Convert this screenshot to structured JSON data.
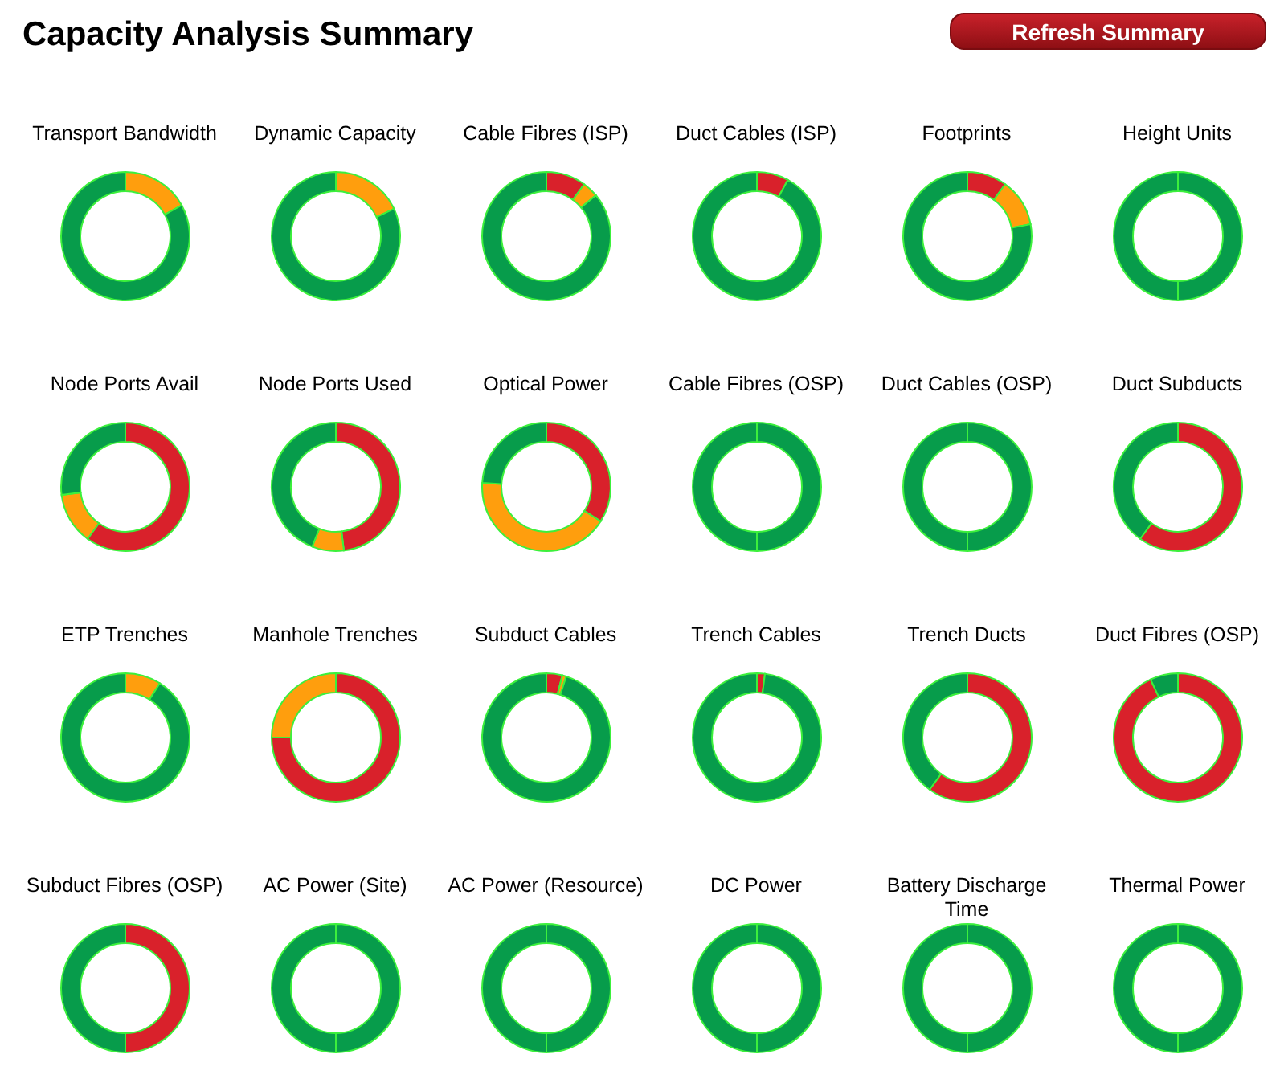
{
  "title": "Capacity Analysis Summary",
  "refresh_button": "Refresh Summary",
  "gauges": [
    {
      "label": "Transport Bandwidth",
      "chart_data": {
        "type": "donut",
        "values": [
          17,
          83
        ],
        "colors": [
          "#ff9e0d",
          "#079c4b"
        ]
      }
    },
    {
      "label": "Dynamic Capacity",
      "chart_data": {
        "type": "donut",
        "values": [
          18,
          82
        ],
        "colors": [
          "#ff9e0d",
          "#079c4b"
        ]
      }
    },
    {
      "label": "Cable Fibres (ISP)",
      "chart_data": {
        "type": "donut",
        "values": [
          10,
          4,
          86
        ],
        "colors": [
          "#d9212b",
          "#ff9e0d",
          "#079c4b"
        ]
      }
    },
    {
      "label": "Duct Cables (ISP)",
      "chart_data": {
        "type": "donut",
        "values": [
          8,
          92
        ],
        "colors": [
          "#d9212b",
          "#079c4b"
        ]
      }
    },
    {
      "label": "Footprints",
      "chart_data": {
        "type": "donut",
        "values": [
          10,
          12,
          78
        ],
        "colors": [
          "#d9212b",
          "#ff9e0d",
          "#079c4b"
        ]
      }
    },
    {
      "label": "Height Units",
      "chart_data": {
        "type": "donut",
        "values": [
          50,
          50
        ],
        "colors": [
          "#079c4b",
          "#079c4b"
        ]
      }
    },
    {
      "label": "Node Ports Avail",
      "chart_data": {
        "type": "donut",
        "values": [
          60,
          13,
          27
        ],
        "colors": [
          "#d9212b",
          "#ff9e0d",
          "#079c4b"
        ]
      }
    },
    {
      "label": "Node Ports Used",
      "chart_data": {
        "type": "donut",
        "values": [
          48,
          8,
          44
        ],
        "colors": [
          "#d9212b",
          "#ff9e0d",
          "#079c4b"
        ]
      }
    },
    {
      "label": "Optical Power",
      "chart_data": {
        "type": "donut",
        "values": [
          34,
          42,
          24
        ],
        "colors": [
          "#d9212b",
          "#ff9e0d",
          "#079c4b"
        ]
      }
    },
    {
      "label": "Cable Fibres (OSP)",
      "chart_data": {
        "type": "donut",
        "values": [
          50,
          50
        ],
        "colors": [
          "#079c4b",
          "#079c4b"
        ]
      }
    },
    {
      "label": "Duct Cables (OSP)",
      "chart_data": {
        "type": "donut",
        "values": [
          50,
          50
        ],
        "colors": [
          "#079c4b",
          "#079c4b"
        ]
      }
    },
    {
      "label": "Duct Subducts",
      "chart_data": {
        "type": "donut",
        "values": [
          60,
          40
        ],
        "colors": [
          "#d9212b",
          "#079c4b"
        ]
      }
    },
    {
      "label": "ETP Trenches",
      "chart_data": {
        "type": "donut",
        "values": [
          9,
          91
        ],
        "colors": [
          "#ff9e0d",
          "#079c4b"
        ]
      }
    },
    {
      "label": "Manhole Trenches",
      "chart_data": {
        "type": "donut",
        "values": [
          75,
          25
        ],
        "colors": [
          "#d9212b",
          "#ff9e0d"
        ]
      }
    },
    {
      "label": "Subduct Cables",
      "chart_data": {
        "type": "donut",
        "values": [
          4,
          1,
          95
        ],
        "colors": [
          "#d9212b",
          "#ff9e0d",
          "#079c4b"
        ]
      }
    },
    {
      "label": "Trench Cables",
      "chart_data": {
        "type": "donut",
        "values": [
          2,
          98
        ],
        "colors": [
          "#d9212b",
          "#079c4b"
        ]
      }
    },
    {
      "label": "Trench Ducts",
      "chart_data": {
        "type": "donut",
        "values": [
          60,
          40
        ],
        "colors": [
          "#d9212b",
          "#079c4b"
        ]
      }
    },
    {
      "label": "Duct Fibres (OSP)",
      "chart_data": {
        "type": "donut",
        "values": [
          93,
          7
        ],
        "colors": [
          "#d9212b",
          "#079c4b"
        ]
      }
    },
    {
      "label": "Subduct Fibres (OSP)",
      "chart_data": {
        "type": "donut",
        "values": [
          50,
          50
        ],
        "colors": [
          "#d9212b",
          "#079c4b"
        ]
      }
    },
    {
      "label": "AC Power (Site)",
      "chart_data": {
        "type": "donut",
        "values": [
          50,
          50
        ],
        "colors": [
          "#079c4b",
          "#079c4b"
        ]
      }
    },
    {
      "label": "AC Power (Resource)",
      "chart_data": {
        "type": "donut",
        "values": [
          50,
          50
        ],
        "colors": [
          "#079c4b",
          "#079c4b"
        ]
      }
    },
    {
      "label": "DC Power",
      "chart_data": {
        "type": "donut",
        "values": [
          50,
          50
        ],
        "colors": [
          "#079c4b",
          "#079c4b"
        ]
      }
    },
    {
      "label": "Battery Discharge Time",
      "chart_data": {
        "type": "donut",
        "values": [
          50,
          50
        ],
        "colors": [
          "#079c4b",
          "#079c4b"
        ]
      }
    },
    {
      "label": "Thermal Power",
      "chart_data": {
        "type": "donut",
        "values": [
          50,
          50
        ],
        "colors": [
          "#079c4b",
          "#079c4b"
        ]
      }
    }
  ]
}
